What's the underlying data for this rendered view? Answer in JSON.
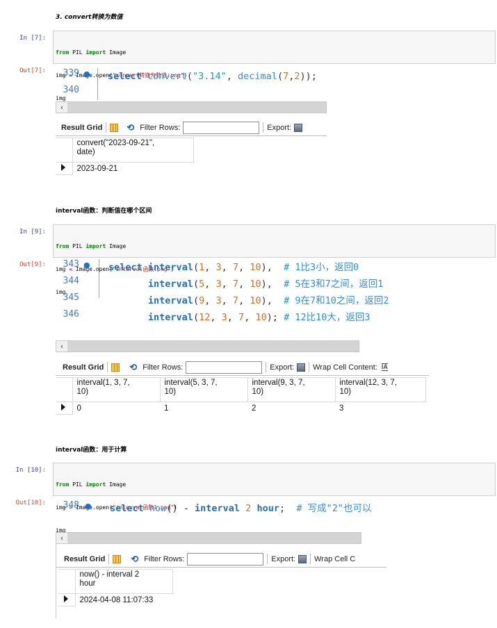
{
  "sections": [
    {
      "heading": "3. convert转换为数值",
      "in_prompt": "In  [7]:",
      "out_prompt": "Out[7]:",
      "code": [
        "from PIL import Image",
        "img = Image.open(\"convert转换为数值.png\")",
        "img"
      ],
      "editor_lines": [
        {
          "num": "339",
          "code": "select convert(\"3.14\", decimal(7,2));"
        },
        {
          "num": "340",
          "code": ""
        }
      ],
      "columns": [
        "convert(\"2023-09-21\",\ndate)"
      ],
      "row": [
        "2023-09-21"
      ]
    },
    {
      "heading": "interval函数：判断值在哪个区间",
      "in_prompt": "In  [9]:",
      "out_prompt": "Out[9]:",
      "code": [
        "from PIL import Image",
        "img = Image.open(\"interval函数.png\")",
        "img"
      ],
      "editor_lines": [
        {
          "num": "343",
          "code": "select interval(1, 3, 7, 10),  # 1比3小，返回0"
        },
        {
          "num": "344",
          "code": "       interval(5, 3, 7, 10),  # 5在3和7之间，返回1"
        },
        {
          "num": "345",
          "code": "       interval(9, 3, 7, 10),  # 9在7和10之间，返回2"
        },
        {
          "num": "346",
          "code": "       interval(12, 3, 7, 10); # 12比10大，返回3"
        }
      ],
      "columns": [
        "interval(1, 3, 7,\n10)",
        "interval(5, 3, 7,\n10)",
        "interval(9, 3, 7,\n10)",
        "interval(12, 3, 7,\n10)"
      ],
      "row": [
        "0",
        "1",
        "2",
        "3"
      ]
    },
    {
      "heading": "interval函数：用于计算",
      "in_prompt": "In  [10]:",
      "out_prompt": "Out[10]:",
      "code": [
        "from PIL import Image",
        "img = Image.open(\"interval函数1.png\")",
        "img"
      ],
      "editor_lines": [
        {
          "num": "348",
          "code": "select now() - interval 2 hour;  # 写成\"2\"也可以"
        }
      ],
      "columns": [
        "now() - interval 2\nhour"
      ],
      "row": [
        "2024-04-08 11:07:33"
      ]
    }
  ],
  "toolbar": {
    "result_grid": "Result Grid",
    "filter_rows": "Filter Rows:",
    "export": "Export:",
    "wrap_cell": "Wrap Cell Content:",
    "wrap_cell_cut": "Wrap Cell C"
  },
  "icons": {
    "scroll_left": "‹",
    "refresh": "⟲",
    "wrap": "IA"
  }
}
